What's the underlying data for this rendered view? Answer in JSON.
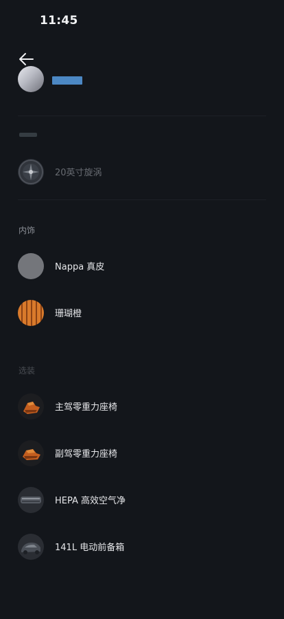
{
  "status_bar": {
    "time": "11:45"
  },
  "header": {
    "back_icon": "arrow-left-icon"
  },
  "colors": {
    "background": "#13161b",
    "title_highlight": "#4c88c4",
    "accent_orange": "#d97a2b"
  },
  "exterior": {
    "wheel": {
      "label": "20英寸旋涡",
      "icon": "wheel-icon"
    }
  },
  "interior": {
    "title": "内饰",
    "items": [
      {
        "label": "Nappa 真皮",
        "icon": "gray-swatch-icon"
      },
      {
        "label": "珊瑚橙",
        "icon": "orange-wood-swatch-icon"
      }
    ]
  },
  "options": {
    "title": "选装",
    "items": [
      {
        "label": "主驾零重力座椅",
        "icon": "seat-icon"
      },
      {
        "label": "副驾零重力座椅",
        "icon": "seat-icon"
      },
      {
        "label": "HEPA 高效空气净",
        "icon": "air-filter-icon"
      },
      {
        "label": "141L 电动前备箱",
        "icon": "front-trunk-icon"
      }
    ]
  }
}
